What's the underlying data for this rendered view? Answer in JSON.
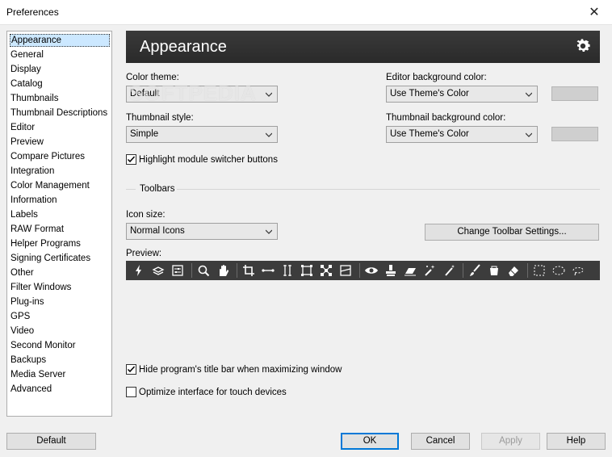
{
  "window": {
    "title": "Preferences",
    "close_label": "✕"
  },
  "sidebar": {
    "items": [
      {
        "label": "Appearance",
        "selected": true
      },
      {
        "label": "General"
      },
      {
        "label": "Display"
      },
      {
        "label": "Catalog"
      },
      {
        "label": "Thumbnails"
      },
      {
        "label": "Thumbnail Descriptions"
      },
      {
        "label": "Editor"
      },
      {
        "label": "Preview"
      },
      {
        "label": "Compare Pictures"
      },
      {
        "label": "Integration"
      },
      {
        "label": "Color Management"
      },
      {
        "label": "Information"
      },
      {
        "label": "Labels"
      },
      {
        "label": "RAW Format"
      },
      {
        "label": "Helper Programs"
      },
      {
        "label": "Signing Certificates"
      },
      {
        "label": "Other"
      },
      {
        "label": "Filter Windows"
      },
      {
        "label": "Plug-ins"
      },
      {
        "label": "GPS"
      },
      {
        "label": "Video"
      },
      {
        "label": "Second Monitor"
      },
      {
        "label": "Backups"
      },
      {
        "label": "Media Server"
      },
      {
        "label": "Advanced"
      }
    ]
  },
  "header": {
    "title": "Appearance",
    "icon": "gear-icon"
  },
  "watermark": "SOFTPEDIA",
  "form": {
    "color_theme": {
      "label": "Color theme:",
      "value": "Default"
    },
    "thumbnail_style": {
      "label": "Thumbnail style:",
      "value": "Simple"
    },
    "editor_bg": {
      "label": "Editor background color:",
      "value": "Use Theme's Color",
      "swatch": "#cfcfcf"
    },
    "thumbnail_bg": {
      "label": "Thumbnail background color:",
      "value": "Use Theme's Color",
      "swatch": "#cfcfcf"
    },
    "highlight_switcher": {
      "label": "Highlight module switcher buttons",
      "checked": true
    },
    "toolbars_section": "Toolbars",
    "icon_size": {
      "label": "Icon size:",
      "value": "Normal Icons"
    },
    "change_toolbar_button": "Change Toolbar Settings...",
    "preview_label": "Preview:",
    "hide_title_bar": {
      "label": "Hide program's title bar when maximizing window",
      "checked": true
    },
    "touch_optimize": {
      "label": "Optimize interface for touch devices",
      "checked": false
    }
  },
  "toolbar_icons": [
    "flash-icon",
    "layers-icon",
    "adjust-panel-icon",
    "sep",
    "zoom-icon",
    "hand-icon",
    "sep",
    "crop-icon",
    "horizontal-line-icon",
    "vertical-line-icon",
    "resize-icon",
    "transform-icon",
    "split-icon",
    "sep",
    "eye-icon",
    "stamp-icon",
    "eraser-block-icon",
    "retouch-icon",
    "brush-sparkle-icon",
    "sep",
    "paint-brush-icon",
    "bucket-icon",
    "eraser-icon",
    "sep",
    "rect-select-icon",
    "ellipse-select-icon",
    "lasso-icon",
    "poly-lasso-icon"
  ],
  "footer": {
    "default": "Default",
    "ok": "OK",
    "cancel": "Cancel",
    "apply": "Apply",
    "help": "Help"
  },
  "colors": {
    "header_bg": "#333333",
    "toolbar_bg": "#3c3c3c",
    "selection": "#cce8ff",
    "accent": "#0078d7"
  }
}
